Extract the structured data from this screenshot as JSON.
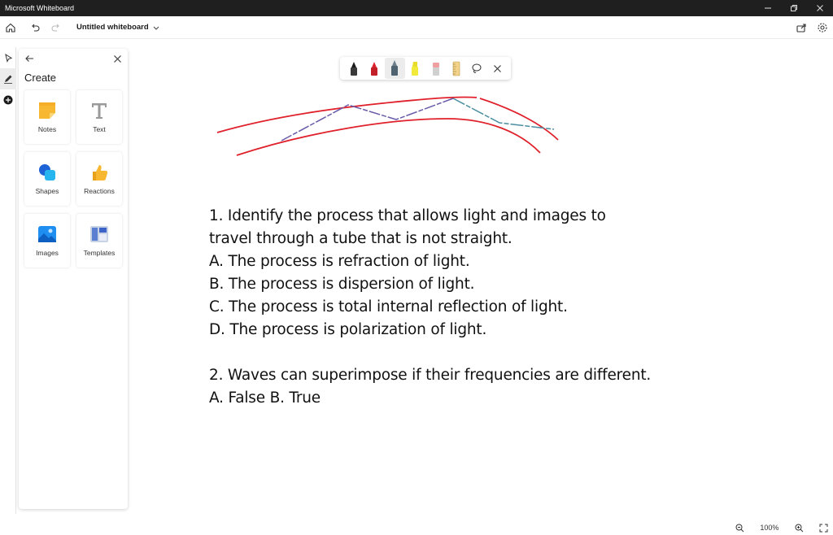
{
  "window": {
    "title": "Microsoft Whiteboard"
  },
  "toolbar": {
    "board_title": "Untitled whiteboard"
  },
  "panel": {
    "title": "Create",
    "tiles": [
      {
        "label": "Notes",
        "icon": "sticky-note-icon"
      },
      {
        "label": "Text",
        "icon": "text-icon"
      },
      {
        "label": "Shapes",
        "icon": "shapes-icon"
      },
      {
        "label": "Reactions",
        "icon": "thumbs-up-icon"
      },
      {
        "label": "Images",
        "icon": "image-icon"
      },
      {
        "label": "Templates",
        "icon": "templates-icon"
      }
    ]
  },
  "ink_tools": {
    "selected": "pen-gray",
    "colors": {
      "black": "#1a1a1a",
      "red": "#d9232e",
      "gray": "#6e7f8a",
      "highlighter": "#f2ea3a",
      "eraser": "#f0a0a0"
    }
  },
  "sketch": {
    "outer_color": "#e0202b",
    "inner_colors": [
      "#6a5aa8",
      "#4a8ea0"
    ]
  },
  "content": {
    "lines": [
      "1. Identify the process that allows light and images to",
      "travel through a tube that is not straight.",
      "A. The process is refraction of light.",
      "B. The process is dispersion of light.",
      "C. The process is total internal reflection of light.",
      "D. The process is polarization of light.",
      "",
      "2. Waves can superimpose if their frequencies are different.",
      "A. False B. True"
    ]
  },
  "zoom": {
    "level": "100%"
  }
}
